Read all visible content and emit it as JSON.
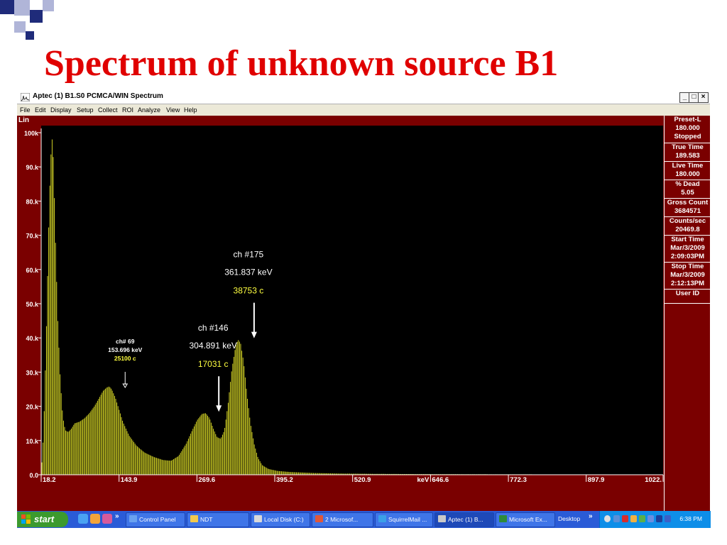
{
  "slide": {
    "title": "Spectrum of unknown source B1"
  },
  "window": {
    "title": "Aptec (1) B1.S0 PCMCA/WIN Spectrum",
    "controls": {
      "minimize": "_",
      "restore": "□",
      "close": "×"
    },
    "menu": [
      "File",
      "Edit",
      "Display",
      "Setup",
      "Collect",
      "ROI",
      "Analyze",
      "View",
      "Help"
    ],
    "scale_mode": "Lin"
  },
  "colors": {
    "spectrum": "#e6e629",
    "panel": "#7a0000",
    "plot_bg": "#000000",
    "title": "#e00000",
    "highlight": "#ffff40"
  },
  "info_panel": [
    {
      "label": "Preset-L",
      "value": "180.000",
      "extra": "Stopped"
    },
    {
      "label": "True Time",
      "value": "189.583"
    },
    {
      "label": "Live Time",
      "value": "180.000"
    },
    {
      "label": "% Dead",
      "value": "5.05"
    },
    {
      "label": "Gross Count",
      "value": "3684571"
    },
    {
      "label": "Counts/sec",
      "value": "20469.8"
    },
    {
      "label": "Start Time",
      "value": "Mar/3/2009",
      "extra": "2:09:03PM"
    },
    {
      "label": "Stop Time",
      "value": "Mar/3/2009",
      "extra": "2:12:13PM"
    },
    {
      "label": "User ID",
      "value": ""
    }
  ],
  "chart_data": {
    "type": "bar",
    "ylim": [
      0,
      100000
    ],
    "y_ticks": [
      {
        "value": 0,
        "label": "0.0"
      },
      {
        "value": 10000,
        "label": "10.k"
      },
      {
        "value": 20000,
        "label": "20.k"
      },
      {
        "value": 30000,
        "label": "30.k"
      },
      {
        "value": 40000,
        "label": "40.k"
      },
      {
        "value": 50000,
        "label": "50.k"
      },
      {
        "value": 60000,
        "label": "60.k"
      },
      {
        "value": 70000,
        "label": "70.k"
      },
      {
        "value": 80000,
        "label": "80.k"
      },
      {
        "value": 90000,
        "label": "90.k"
      },
      {
        "value": 100000,
        "label": "100k"
      }
    ],
    "xlim": [
      18.2,
      1022
    ],
    "x_ticks": [
      {
        "value": 18.2,
        "label": "18.2"
      },
      {
        "value": 143.9,
        "label": "143.9"
      },
      {
        "value": 269.6,
        "label": "269.6"
      },
      {
        "value": 395.2,
        "label": "395.2"
      },
      {
        "value": 520.9,
        "label": "520.9"
      },
      {
        "value": 646.6,
        "label": "646.6"
      },
      {
        "value": 772.3,
        "label": "772.3"
      },
      {
        "value": 897.9,
        "label": "897.9"
      },
      {
        "value": 1022,
        "label": "1022."
      }
    ],
    "x_unit_label": "keV",
    "points": [
      [
        18.2,
        0
      ],
      [
        22,
        12000
      ],
      [
        26,
        38000
      ],
      [
        30,
        70000
      ],
      [
        33,
        90000
      ],
      [
        35.5,
        99000
      ],
      [
        38,
        92000
      ],
      [
        41,
        70000
      ],
      [
        45,
        45000
      ],
      [
        49,
        28000
      ],
      [
        53,
        17000
      ],
      [
        57,
        13000
      ],
      [
        62,
        12500
      ],
      [
        67,
        13500
      ],
      [
        72,
        15000
      ],
      [
        80,
        15500
      ],
      [
        88,
        16500
      ],
      [
        96,
        18000
      ],
      [
        104,
        20000
      ],
      [
        112,
        22500
      ],
      [
        118,
        24500
      ],
      [
        124,
        25500
      ],
      [
        128,
        25800
      ],
      [
        132,
        25000
      ],
      [
        138,
        22500
      ],
      [
        144,
        19000
      ],
      [
        150,
        15500
      ],
      [
        160,
        11500
      ],
      [
        172,
        8500
      ],
      [
        185,
        6500
      ],
      [
        200,
        5200
      ],
      [
        215,
        4300
      ],
      [
        228,
        4100
      ],
      [
        240,
        5500
      ],
      [
        252,
        9000
      ],
      [
        262,
        13000
      ],
      [
        270,
        16000
      ],
      [
        278,
        17800
      ],
      [
        284,
        18000
      ],
      [
        290,
        16500
      ],
      [
        296,
        13500
      ],
      [
        302,
        11000
      ],
      [
        308,
        10500
      ],
      [
        314,
        13000
      ],
      [
        320,
        21000
      ],
      [
        326,
        31000
      ],
      [
        332,
        37500
      ],
      [
        336,
        39500
      ],
      [
        340,
        38500
      ],
      [
        345,
        33000
      ],
      [
        350,
        24000
      ],
      [
        356,
        15000
      ],
      [
        362,
        9000
      ],
      [
        368,
        5000
      ],
      [
        375,
        2800
      ],
      [
        385,
        1700
      ],
      [
        400,
        1100
      ],
      [
        420,
        800
      ],
      [
        460,
        500
      ],
      [
        500,
        350
      ],
      [
        560,
        250
      ],
      [
        640,
        180
      ],
      [
        750,
        130
      ],
      [
        900,
        90
      ],
      [
        1022,
        60
      ]
    ],
    "annotations": [
      {
        "energy": 153.696,
        "arrow_value": 25100,
        "ch": "ch# 69",
        "kev": "153.696 keV",
        "counts": "25100 c"
      },
      {
        "energy": 304.891,
        "arrow_value": 18000,
        "ch": "ch #146",
        "kev": "304.891 keV",
        "counts": "17031 c"
      },
      {
        "energy": 361.837,
        "arrow_value": 39500,
        "ch": "ch #175",
        "kev": "361.837  keV",
        "counts": "38753 c"
      }
    ]
  },
  "taskbar": {
    "start": "start",
    "items": [
      {
        "label": "Control Panel",
        "color": "#6aa2f0"
      },
      {
        "label": "NDT",
        "color": "#f2c94c"
      },
      {
        "label": "Local Disk (C:)",
        "color": "#d9d9d9"
      },
      {
        "label": "2 Microsof...",
        "color": "#e0573a"
      },
      {
        "label": "SquirrelMail ...",
        "color": "#3aa0e8"
      },
      {
        "label": "Aptec (1) B...",
        "color": "#c9c9c9"
      },
      {
        "label": "Microsoft Ex...",
        "color": "#2e8b3a"
      }
    ],
    "desktop": "Desktop",
    "clock": "6:38 PM"
  }
}
